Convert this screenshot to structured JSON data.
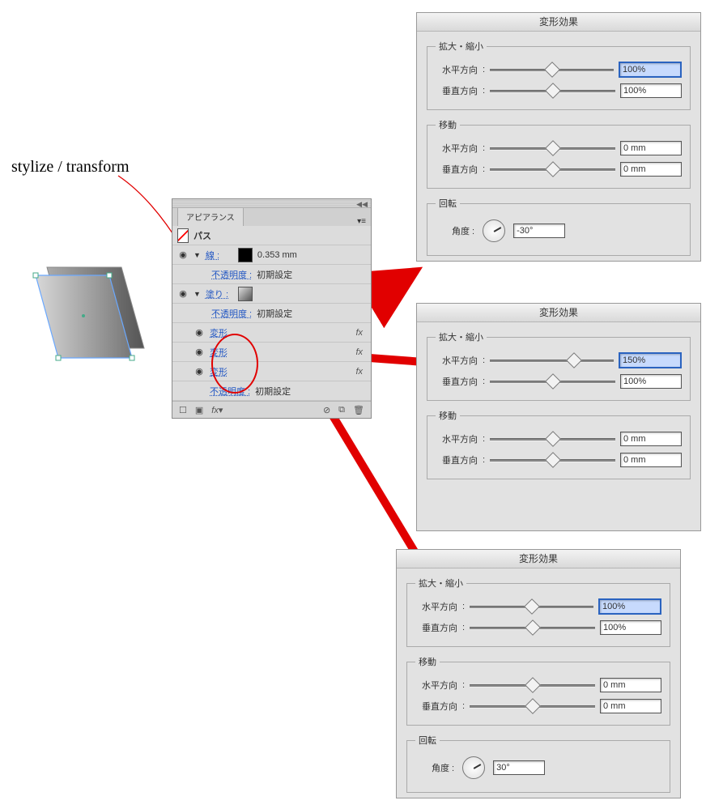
{
  "annotation": {
    "label": "stylize / transform"
  },
  "appearance": {
    "title": "アピアランス",
    "path_label": "パス",
    "stroke": {
      "label": "線 :",
      "value": "0.353 mm"
    },
    "opacity_label": "不透明度 :",
    "opacity_default": "初期設定",
    "fill_label": "塗り :",
    "transform_label": "変形",
    "fx_label": "fx"
  },
  "transform_dialog": {
    "title": "変形効果",
    "group_scale": "拡大・縮小",
    "group_move": "移動",
    "group_rotate": "回転",
    "h_label": "水平方向",
    "v_label": "垂直方向",
    "angle_label": "角度 :"
  },
  "dlg1": {
    "scale_h": "100%",
    "scale_v": "100%",
    "move_h": "0 mm",
    "move_v": "0 mm",
    "angle": "-30°"
  },
  "dlg2": {
    "scale_h": "150%",
    "scale_v": "100%",
    "move_h": "0 mm",
    "move_v": "0 mm"
  },
  "dlg3": {
    "scale_h": "100%",
    "scale_v": "100%",
    "move_h": "0 mm",
    "move_v": "0 mm",
    "angle": "30°"
  }
}
